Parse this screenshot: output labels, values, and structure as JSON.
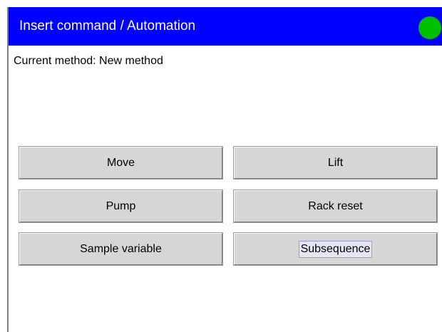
{
  "window": {
    "title": "Insert command / Automation",
    "status_color": "#00bf00",
    "accent_color": "#0000fe"
  },
  "method": {
    "current_label": "Current method: New method"
  },
  "commands": {
    "move": "Move",
    "lift": "Lift",
    "pump": "Pump",
    "rack_reset": "Rack reset",
    "sample_variable": "Sample variable",
    "subsequence": "Subsequence"
  }
}
